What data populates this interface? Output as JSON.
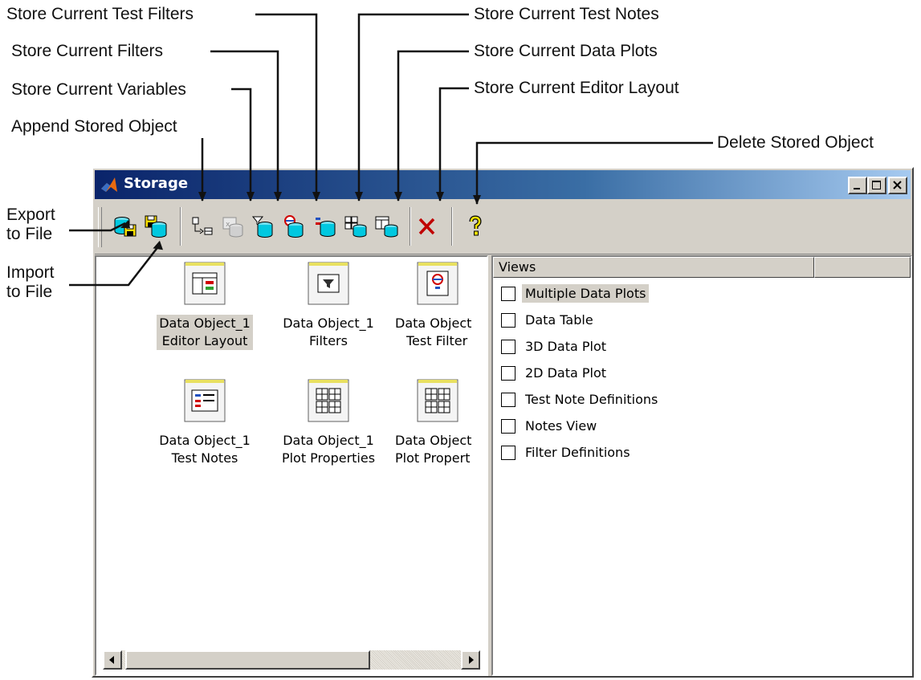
{
  "callouts": {
    "store_test_filters": "Store Current Test Filters",
    "store_filters": "Store Current Filters",
    "store_variables": "Store Current Variables",
    "append_stored_object": "Append Stored Object",
    "store_test_notes": "Store Current Test Notes",
    "store_data_plots": "Store Current Data Plots",
    "store_editor_layout": "Store Current Editor Layout",
    "delete_stored_object": "Delete Stored Object",
    "export_line1": "Export",
    "export_line2": "to File",
    "import_line1": "Import",
    "import_line2": "to File"
  },
  "window": {
    "title": "Storage",
    "minimize_label": "_",
    "close_label": "×"
  },
  "toolbar": {
    "icons": [
      "export-to-file-icon",
      "import-from-file-icon",
      "append-stored-object-icon",
      "store-variables-icon",
      "store-filters-icon",
      "store-test-filters-icon",
      "store-test-notes-icon",
      "store-data-plots-icon",
      "store-editor-layout-icon",
      "delete-stored-object-icon",
      "help-icon"
    ]
  },
  "objects": [
    {
      "line1": "Data Object_1",
      "line2": "Editor Layout",
      "icon": "editor-layout-object-icon",
      "selected": true
    },
    {
      "line1": "Data Object_1",
      "line2": "Filters",
      "icon": "filters-object-icon",
      "selected": false
    },
    {
      "line1": "Data Object",
      "line2": "Test Filter",
      "icon": "test-filters-object-icon",
      "selected": false
    },
    {
      "line1": "Data Object_1",
      "line2": "Test Notes",
      "icon": "test-notes-object-icon",
      "selected": false
    },
    {
      "line1": "Data Object_1",
      "line2": "Plot Properties",
      "icon": "plot-properties-object-icon",
      "selected": false
    },
    {
      "line1": "Data Object",
      "line2": "Plot Propert",
      "icon": "plot-properties-object-icon",
      "selected": false
    }
  ],
  "views": {
    "header": "Views",
    "items": [
      {
        "label": "Multiple Data Plots",
        "checked": false,
        "selected": true
      },
      {
        "label": "Data Table",
        "checked": false,
        "selected": false
      },
      {
        "label": "3D Data Plot",
        "checked": false,
        "selected": false
      },
      {
        "label": "2D Data Plot",
        "checked": false,
        "selected": false
      },
      {
        "label": "Test Note Definitions",
        "checked": false,
        "selected": false
      },
      {
        "label": "Notes View",
        "checked": false,
        "selected": false
      },
      {
        "label": "Filter Definitions",
        "checked": false,
        "selected": false
      }
    ]
  },
  "colors": {
    "titlebar_start": "#0a246a",
    "titlebar_end": "#a6caf0",
    "face": "#d4d0c8",
    "db_cyan": "#00c8e0",
    "delete_red": "#c00000"
  }
}
